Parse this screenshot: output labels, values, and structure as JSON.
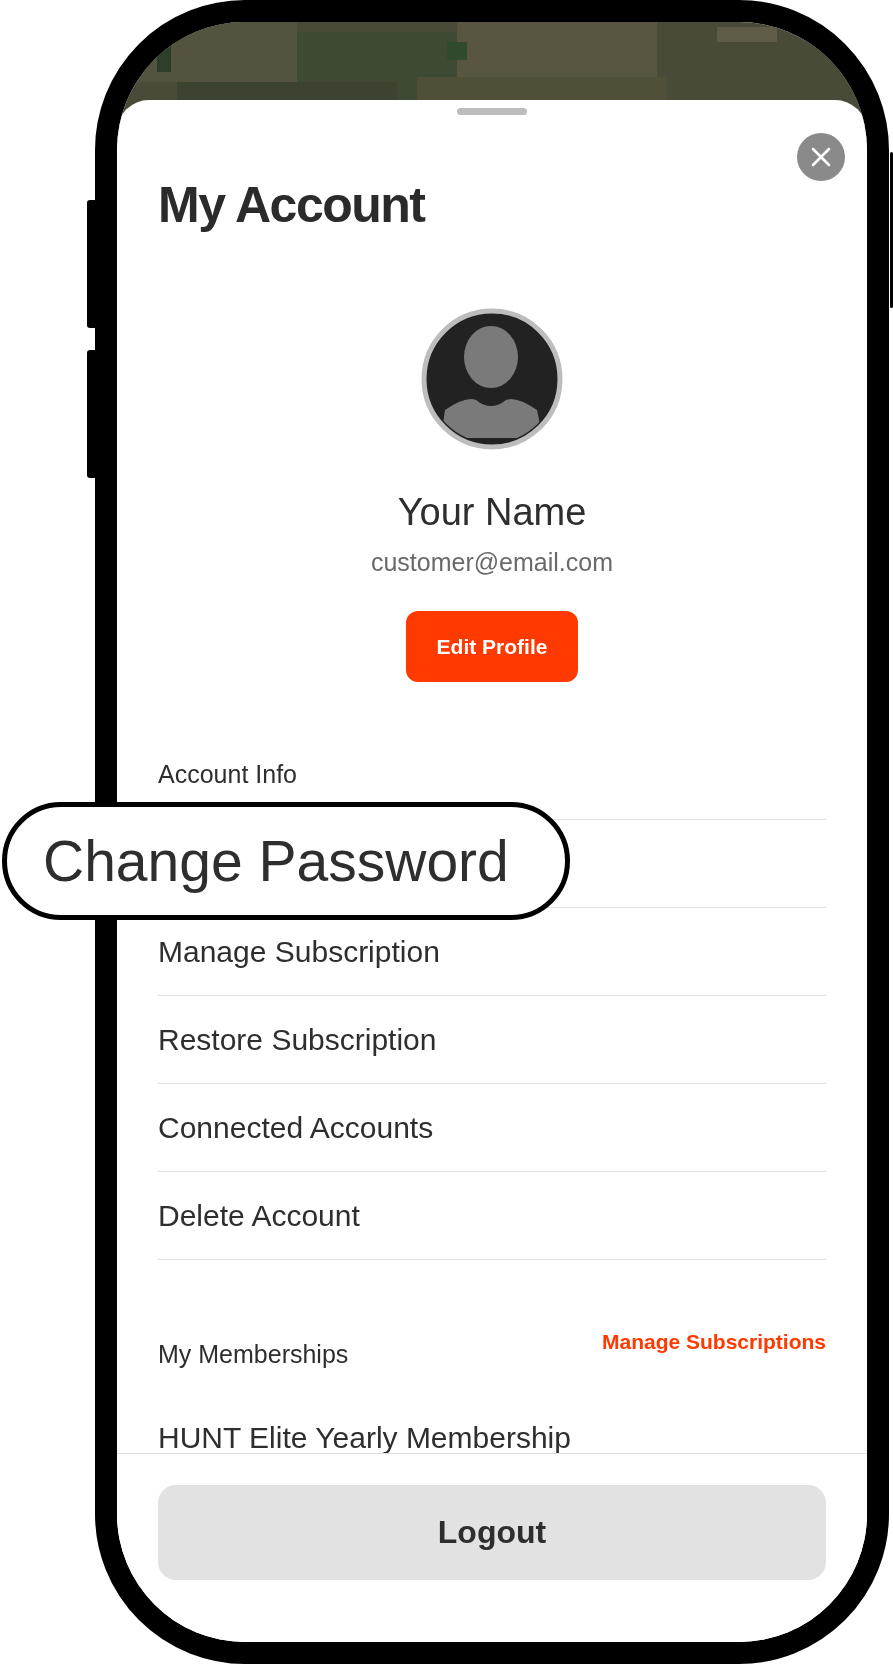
{
  "sheet": {
    "title": "My Account",
    "profile": {
      "name": "Your Name",
      "email": "customer@email.com",
      "edit_button": "Edit Profile"
    },
    "account_info": {
      "heading": "Account Info",
      "items": [
        {
          "label": "Change Password",
          "highlighted": true
        },
        {
          "label": "Manage Subscription",
          "highlighted": false
        },
        {
          "label": "Restore Subscription",
          "highlighted": false
        },
        {
          "label": "Connected Accounts",
          "highlighted": false
        },
        {
          "label": "Delete Account",
          "highlighted": false
        }
      ]
    },
    "memberships": {
      "heading": "My Memberships",
      "link": "Manage Subscriptions",
      "items": [
        "HUNT Elite Yearly Membership"
      ]
    },
    "logout_button": "Logout"
  }
}
